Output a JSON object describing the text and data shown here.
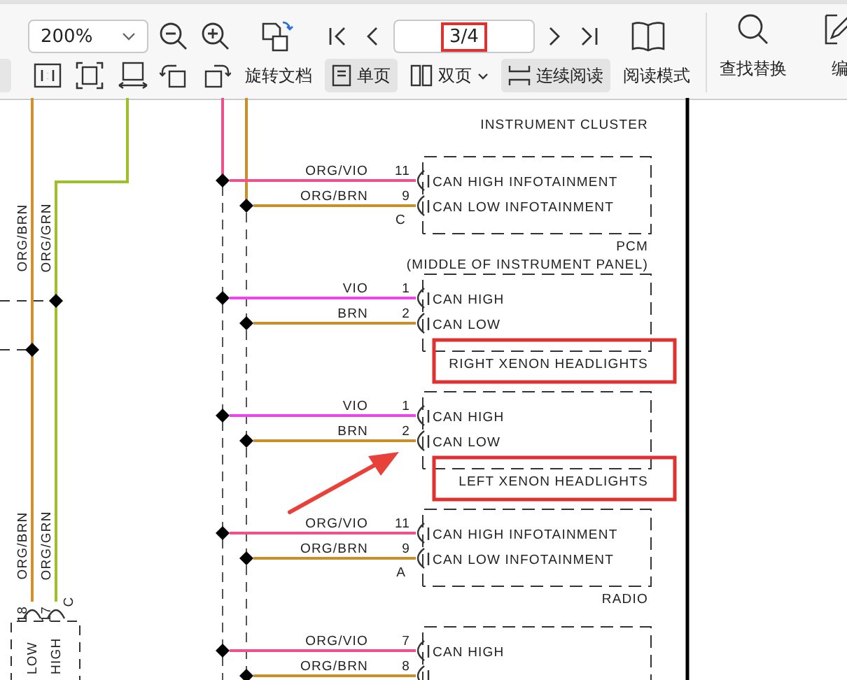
{
  "toolbar": {
    "zoom": {
      "value": "200%"
    },
    "page": {
      "value": "3/4",
      "highlighted": true
    },
    "view_buttons": [
      {
        "label": "旋转文档",
        "kind": "plain",
        "selected": false
      },
      {
        "label": "单页",
        "kind": "single",
        "selected": true
      },
      {
        "label": "双页",
        "kind": "double",
        "selected": false
      },
      {
        "label": "连续阅读",
        "kind": "continuous",
        "selected": true
      },
      {
        "label": "阅读模式",
        "kind": "plain",
        "selected": false
      }
    ],
    "tools": [
      {
        "label": "查找替换",
        "kind": "search"
      },
      {
        "label": "编",
        "kind": "edit"
      }
    ]
  },
  "diagram": {
    "top_caption": "INSTRUMENT CLUSTER",
    "left_harness": {
      "connector": "C",
      "wires": [
        {
          "labels": [
            "ORG/BRN",
            "ORG/BRN"
          ],
          "color": "#d4902a",
          "number": "18",
          "name": "LOW"
        },
        {
          "labels": [
            "ORG/GRN",
            "ORG/GRN"
          ],
          "color": "#9cc02c",
          "number": "17",
          "name": "HIGH"
        }
      ]
    },
    "modules": [
      {
        "connector": "C",
        "caption": [
          "PCM",
          "(MIDDLE OF INSTRUMENT PANEL)"
        ],
        "highlighted": false,
        "pins": [
          {
            "wire_label": "ORG/VIO",
            "color": "#f0508c",
            "number": "11",
            "name": "CAN HIGH INFOTAINMENT"
          },
          {
            "wire_label": "ORG/BRN",
            "color": "#c8902c",
            "number": "9",
            "name": "CAN LOW INFOTAINMENT"
          }
        ]
      },
      {
        "caption": [
          "RIGHT XENON HEADLIGHTS"
        ],
        "highlighted": true,
        "pins": [
          {
            "wire_label": "VIO",
            "color": "#ee44ee",
            "number": "1",
            "name": "CAN HIGH"
          },
          {
            "wire_label": "BRN",
            "color": "#c8902c",
            "number": "2",
            "name": "CAN LOW"
          }
        ]
      },
      {
        "caption": [
          "LEFT XENON HEADLIGHTS"
        ],
        "highlighted": true,
        "pins": [
          {
            "wire_label": "VIO",
            "color": "#ee44ee",
            "number": "1",
            "name": "CAN HIGH"
          },
          {
            "wire_label": "BRN",
            "color": "#c8902c",
            "number": "2",
            "name": "CAN LOW"
          }
        ]
      },
      {
        "connector": "A",
        "caption": [
          "RADIO"
        ],
        "highlighted": false,
        "pins": [
          {
            "wire_label": "ORG/VIO",
            "color": "#f0508c",
            "number": "11",
            "name": "CAN HIGH INFOTAINMENT"
          },
          {
            "wire_label": "ORG/BRN",
            "color": "#c8902c",
            "number": "9",
            "name": "CAN LOW INFOTAINMENT"
          }
        ]
      },
      {
        "highlighted": false,
        "pins": [
          {
            "wire_label": "ORG/VIO",
            "color": "#f0508c",
            "number": "7",
            "name": "CAN HIGH"
          },
          {
            "wire_label": "ORG/BRN",
            "color": "#c8902c",
            "number": "8"
          }
        ]
      }
    ]
  }
}
